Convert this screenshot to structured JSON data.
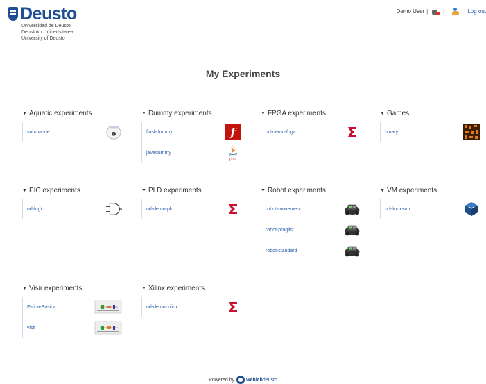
{
  "logo": {
    "word": "Deusto",
    "lines": [
      "Universidad de Deusto",
      "Deustuko Unibertsitatea",
      "University of Deusto"
    ]
  },
  "userbar": {
    "user": "Demo User",
    "separator": "|",
    "logout": "Log out"
  },
  "page_title": "My Experiments",
  "categories": [
    {
      "name": "Aquatic experiments",
      "experiments": [
        {
          "name": "submarine",
          "icon": "webcam-icon"
        }
      ]
    },
    {
      "name": "Dummy experiments",
      "experiments": [
        {
          "name": "flashdummy",
          "icon": "flash-icon"
        },
        {
          "name": "javadummy",
          "icon": "java-icon"
        }
      ]
    },
    {
      "name": "FPGA experiments",
      "experiments": [
        {
          "name": "ud-demo-fpga",
          "icon": "xilinx-icon"
        }
      ]
    },
    {
      "name": "Games",
      "experiments": [
        {
          "name": "binary",
          "icon": "binary-game-icon"
        }
      ]
    },
    {
      "name": "PIC experiments",
      "experiments": [
        {
          "name": "ud-logic",
          "icon": "and-gate-icon"
        }
      ]
    },
    {
      "name": "PLD experiments",
      "experiments": [
        {
          "name": "ud-demo-pld",
          "icon": "xilinx-icon"
        }
      ]
    },
    {
      "name": "Robot experiments",
      "experiments": [
        {
          "name": "robot-movement",
          "icon": "robot-icon"
        },
        {
          "name": "robot-proglist",
          "icon": "robot-icon"
        },
        {
          "name": "robot-standard",
          "icon": "robot-icon"
        }
      ]
    },
    {
      "name": "VM experiments",
      "experiments": [
        {
          "name": "ud-linux-vm",
          "icon": "virtualbox-icon"
        }
      ]
    },
    {
      "name": "Visir experiments",
      "experiments": [
        {
          "name": "Fisica-Basica",
          "icon": "breadboard-icon"
        },
        {
          "name": "visir",
          "icon": "breadboard-icon"
        }
      ]
    },
    {
      "name": "Xilinx experiments",
      "experiments": [
        {
          "name": "ud-demo-xilinx",
          "icon": "xilinx-icon"
        }
      ]
    }
  ],
  "footer": {
    "prefix": "Powered by",
    "brand_bold": "weblab",
    "brand_light": "deusto"
  },
  "colors": {
    "brand": "#1f4e93",
    "link": "#2a5ea8",
    "xilinx": "#c8102e",
    "flash": "#c2140c"
  }
}
